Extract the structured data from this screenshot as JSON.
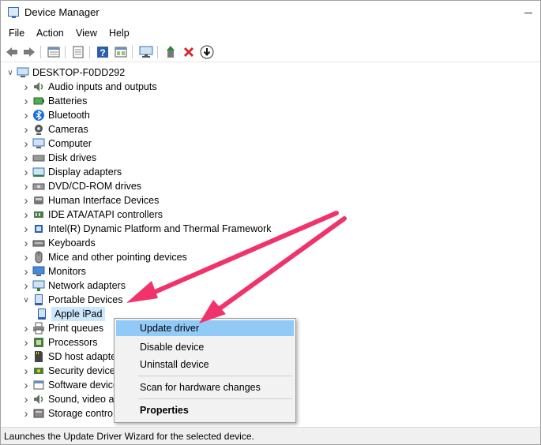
{
  "window": {
    "title": "Device Manager"
  },
  "menu": [
    "File",
    "Action",
    "View",
    "Help"
  ],
  "toolbar": {
    "buttons": [
      "back-arrow-icon",
      "forward-arrow-icon",
      "properties-sheet-icon",
      "tree-view-icon",
      "help-icon",
      "show-hidden-icon",
      "monitor-icon",
      "update-driver-icon",
      "uninstall-icon",
      "download-icon"
    ],
    "colors": {
      "uninstall": "#d9262c",
      "update": "#2a8a2a",
      "help": "#2f5ea8"
    }
  },
  "tree": {
    "root": "DESKTOP-F0DD292",
    "categories": [
      {
        "label": "Audio inputs and outputs",
        "icon": "speaker-icon"
      },
      {
        "label": "Batteries",
        "icon": "battery-icon"
      },
      {
        "label": "Bluetooth",
        "icon": "bluetooth-icon"
      },
      {
        "label": "Cameras",
        "icon": "camera-icon"
      },
      {
        "label": "Computer",
        "icon": "computer-icon"
      },
      {
        "label": "Disk drives",
        "icon": "disk-drive-icon"
      },
      {
        "label": "Display adapters",
        "icon": "display-adapter-icon"
      },
      {
        "label": "DVD/CD-ROM drives",
        "icon": "dvd-drive-icon"
      },
      {
        "label": "Human Interface Devices",
        "icon": "hid-icon"
      },
      {
        "label": "IDE ATA/ATAPI controllers",
        "icon": "ide-controller-icon"
      },
      {
        "label": "Intel(R) Dynamic Platform and Thermal Framework",
        "icon": "chip-icon"
      },
      {
        "label": "Keyboards",
        "icon": "keyboard-icon"
      },
      {
        "label": "Mice and other pointing devices",
        "icon": "mouse-icon"
      },
      {
        "label": "Monitors",
        "icon": "monitor-icon"
      },
      {
        "label": "Network adapters",
        "icon": "network-icon"
      },
      {
        "label": "Portable Devices",
        "icon": "portable-device-icon",
        "expanded": true
      },
      {
        "label": "Apple iPad",
        "icon": "ipad-icon",
        "child": true,
        "selected": true
      },
      {
        "label": "Print queues",
        "icon": "printer-icon"
      },
      {
        "label": "Processors",
        "icon": "processor-icon"
      },
      {
        "label": "SD host adapte",
        "icon": "sd-card-icon"
      },
      {
        "label": "Security device",
        "icon": "security-device-icon"
      },
      {
        "label": "Software device",
        "icon": "software-device-icon"
      },
      {
        "label": "Sound, video a",
        "icon": "sound-icon"
      },
      {
        "label": "Storage contro",
        "icon": "storage-icon"
      }
    ]
  },
  "context_menu": {
    "items": [
      {
        "label": "Update driver",
        "highlighted": true
      },
      {
        "label": "Disable device"
      },
      {
        "label": "Uninstall device"
      },
      {
        "label": "Scan for hardware changes"
      },
      {
        "label": "Properties",
        "bold": true
      }
    ]
  },
  "status": {
    "text": "Launches the Update Driver Wizard for the selected device."
  },
  "annotation": {
    "arrow_color": "#f0336b"
  }
}
